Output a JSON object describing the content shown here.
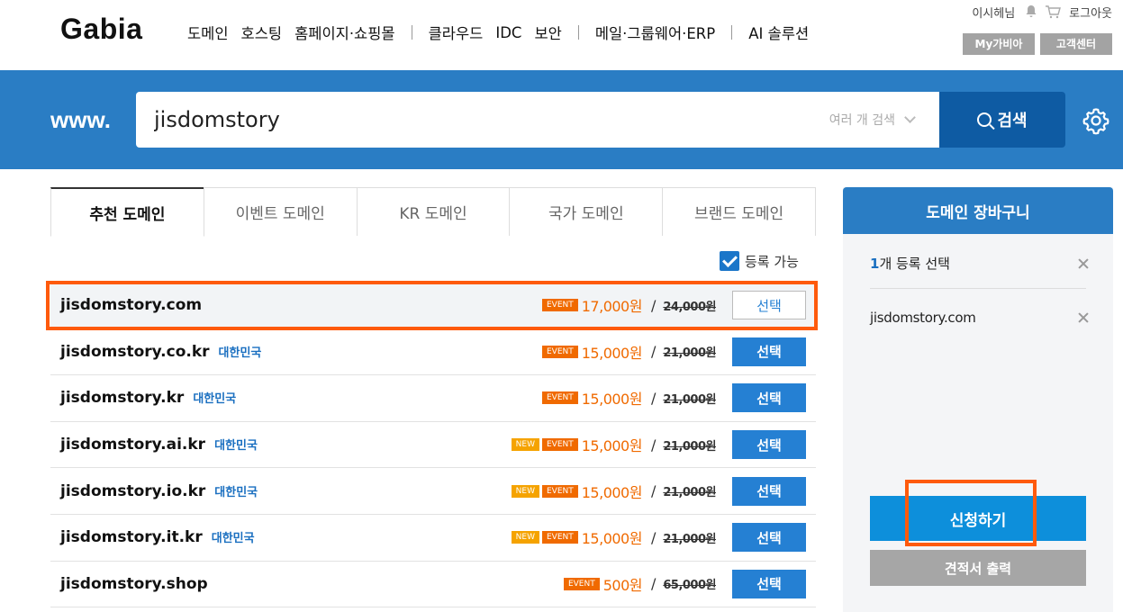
{
  "header": {
    "logo": "Gabia",
    "nav": [
      "도메인",
      "호스팅",
      "홈페이지·쇼핑몰",
      "클라우드",
      "IDC",
      "보안",
      "메일·그룹웨어·ERP",
      "AI 솔루션"
    ],
    "user": "이시헤님",
    "logout": "로그아웃",
    "my_gabia": "My가비아",
    "customer_center": "고객센터"
  },
  "search": {
    "prefix": "www.",
    "value": "jisdomstory",
    "multi_label": "여러 개 검색",
    "button": "검색"
  },
  "tabs": [
    "추천 도메인",
    "이벤트 도메인",
    "KR 도메인",
    "국가 도메인",
    "브랜드 도메인"
  ],
  "available_only": "등록 가능",
  "results": [
    {
      "domain": "jisdomstory.com",
      "country": "",
      "new": false,
      "event": true,
      "price": "17,000원",
      "orig": "24,000원",
      "action": "선택"
    },
    {
      "domain": "jisdomstory.co.kr",
      "country": "대한민국",
      "new": false,
      "event": true,
      "price": "15,000원",
      "orig": "21,000원",
      "action": "선택"
    },
    {
      "domain": "jisdomstory.kr",
      "country": "대한민국",
      "new": false,
      "event": true,
      "price": "15,000원",
      "orig": "21,000원",
      "action": "선택"
    },
    {
      "domain": "jisdomstory.ai.kr",
      "country": "대한민국",
      "new": true,
      "event": true,
      "price": "15,000원",
      "orig": "21,000원",
      "action": "선택"
    },
    {
      "domain": "jisdomstory.io.kr",
      "country": "대한민국",
      "new": true,
      "event": true,
      "price": "15,000원",
      "orig": "21,000원",
      "action": "선택"
    },
    {
      "domain": "jisdomstory.it.kr",
      "country": "대한민국",
      "new": true,
      "event": true,
      "price": "15,000원",
      "orig": "21,000원",
      "action": "선택"
    },
    {
      "domain": "jisdomstory.shop",
      "country": "",
      "new": false,
      "event": true,
      "price": "500원",
      "orig": "65,000원",
      "action": "선택"
    }
  ],
  "badges": {
    "new": "NEW",
    "event": "EVENT"
  },
  "cart": {
    "title": "도메인 장바구니",
    "count": "1",
    "count_label": "개 등록 선택",
    "item": "jisdomstory.com",
    "apply": "신청하기",
    "quote": "견적서 출력"
  },
  "colors": {
    "brand_blue": "#2a7dc4",
    "search_button": "#0e5ba3",
    "event_orange": "#f06a00",
    "new_yellow": "#f5a300",
    "highlight": "#fe5a0c"
  }
}
